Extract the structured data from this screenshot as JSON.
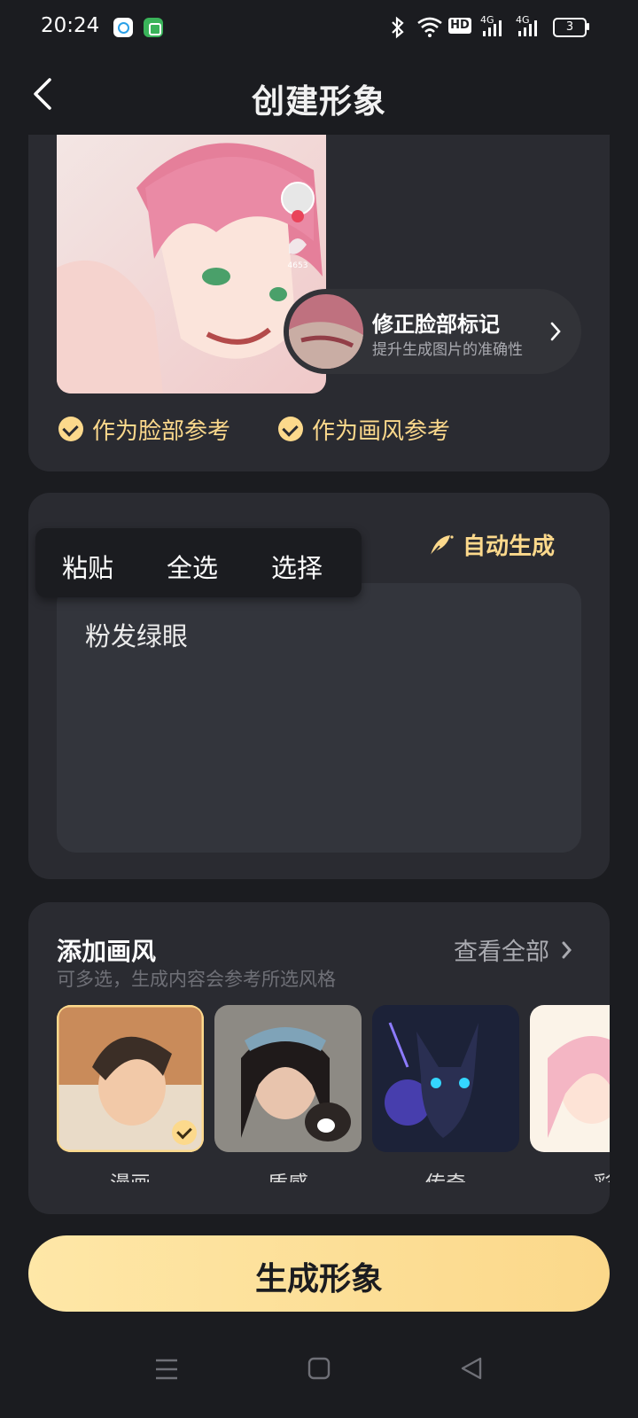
{
  "status_bar": {
    "time": "20:24",
    "hd_badge": "HD",
    "net1": "4G",
    "net2": "4G",
    "battery": "3",
    "icons": [
      "search-app-icon",
      "robot-app-icon",
      "bluetooth-icon",
      "wifi-icon",
      "signal-icon",
      "battery-icon"
    ]
  },
  "header": {
    "title": "创建形象"
  },
  "reference": {
    "portrait_likes": "4653",
    "face_fix_title": "修正脸部标记",
    "face_fix_subtitle": "提升生成图片的准确性",
    "options": [
      {
        "label": "作为脸部参考",
        "checked": true
      },
      {
        "label": "作为画风参考",
        "checked": true
      }
    ]
  },
  "description": {
    "auto_generate_label": "自动生成",
    "text": "粉发绿眼",
    "context_menu": [
      "粘贴",
      "全选",
      "选择"
    ]
  },
  "styles": {
    "title": "添加画风",
    "subtitle": "可多选，生成内容会参考所选风格",
    "view_all": "查看全部",
    "items": [
      {
        "label": "漫画",
        "selected": true
      },
      {
        "label": "质感",
        "selected": false
      },
      {
        "label": "传奇",
        "selected": false
      },
      {
        "label": "彩",
        "selected": false
      }
    ]
  },
  "generate_button": "生成形象",
  "colors": {
    "accent": "#fcd98c",
    "background": "#1b1c20",
    "card": "#2a2b31"
  }
}
